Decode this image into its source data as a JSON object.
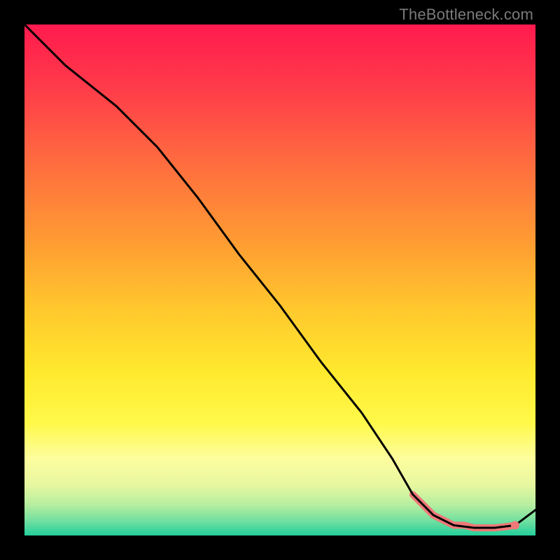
{
  "watermark": "TheBottleneck.com",
  "chart_data": {
    "type": "line",
    "title": "",
    "xlabel": "",
    "ylabel": "",
    "xlim": [
      0,
      100
    ],
    "ylim": [
      0,
      100
    ],
    "grid": false,
    "series": [
      {
        "name": "curve",
        "color": "#000000",
        "x": [
          0,
          8,
          18,
          26,
          34,
          42,
          50,
          58,
          66,
          72,
          76,
          80,
          84,
          88,
          92,
          96,
          100
        ],
        "values": [
          100,
          92,
          84,
          76,
          66,
          55,
          45,
          34,
          24,
          15,
          8,
          4,
          2,
          1.5,
          1.5,
          2,
          5
        ]
      }
    ],
    "markers": {
      "name": "highlight-band",
      "color": "#f07878",
      "x": [
        76,
        78,
        80,
        82,
        84,
        86,
        88,
        90,
        92,
        94,
        96
      ],
      "values": [
        8,
        6,
        4,
        3,
        2,
        2,
        1.5,
        1.5,
        1.5,
        1.7,
        2
      ]
    },
    "end_point": {
      "x": 96,
      "y": 2,
      "color": "#f07878"
    }
  }
}
